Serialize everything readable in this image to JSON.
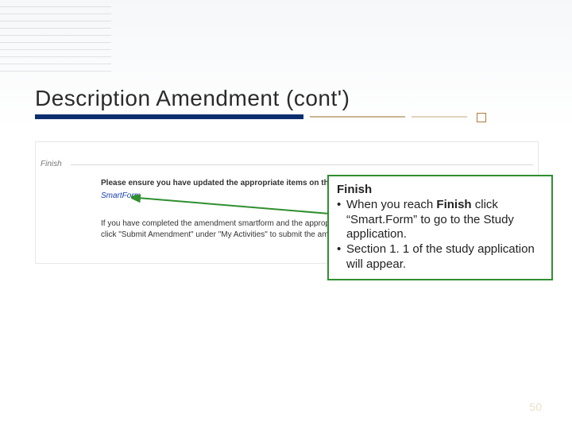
{
  "title": "Description Amendment (cont')",
  "screenshot": {
    "header": "Finish",
    "para1": "Please ensure you have updated the appropriate items on the original study application form",
    "link": "SmartForm",
    "para2": "If you have completed the amendment smartform and the appropriate items on the study amendment workspace. Then click \"Submit Amendment\" under \"My Activities\" to submit the ame"
  },
  "callout": {
    "heading": "Finish",
    "line1a": "When you reach ",
    "line1b": "Finish",
    "line1c": " click “Smart.Form” to go to the Study application.",
    "line2": "Section 1. 1 of the study application will appear."
  },
  "page_number": "50"
}
